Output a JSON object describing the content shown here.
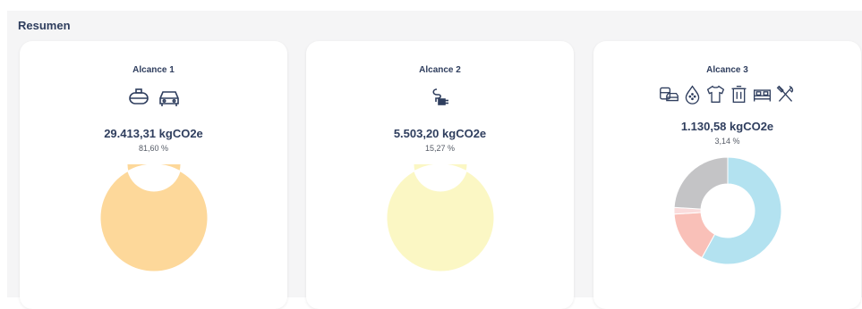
{
  "section": {
    "title": "Resumen"
  },
  "cards": [
    {
      "title": "Alcance 1",
      "total": "29.413,31 kgCO2e",
      "percent": "81,60 %",
      "icons": [
        "gas-tank-icon",
        "car-icon"
      ],
      "chart": {
        "type": "donut",
        "values": [
          100
        ],
        "colors": [
          "#fdd89a"
        ]
      }
    },
    {
      "title": "Alcance 2",
      "total": "5.503,20 kgCO2e",
      "percent": "15,27 %",
      "icons": [
        "electric-plug-icon"
      ],
      "chart": {
        "type": "donut",
        "values": [
          100
        ],
        "colors": [
          "#fbf7c4"
        ]
      }
    },
    {
      "title": "Alcance 3",
      "total": "1.130,58 kgCO2e",
      "percent": "3,14 %",
      "icons": [
        "commute-icon",
        "water-drop-icon",
        "shirt-icon",
        "trash-icon",
        "bed-icon",
        "utensils-icon"
      ],
      "chart": {
        "type": "donut",
        "values": [
          58,
          16,
          2,
          24
        ],
        "colors": [
          "#b3e2f0",
          "#f9c0b8",
          "#fadcdc",
          "#c4c4c6"
        ]
      }
    }
  ]
}
